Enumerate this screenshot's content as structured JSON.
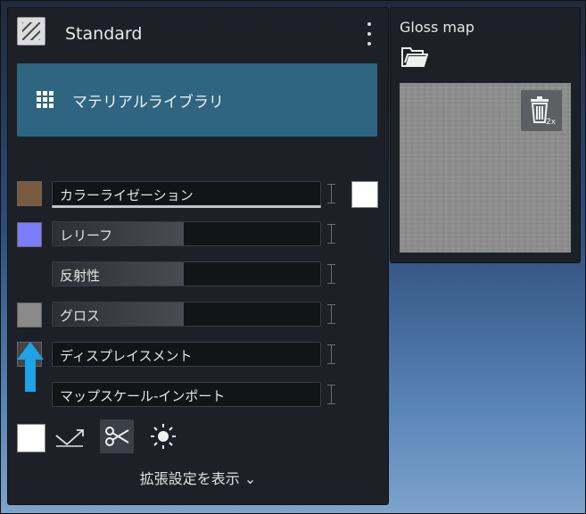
{
  "material": {
    "title": "Standard"
  },
  "library_button": {
    "label": "マテリアルライブラリ"
  },
  "layers": [
    {
      "label": "カラーライゼーション",
      "swatch_color": "#7a5a3c",
      "fill_percent": 0
    },
    {
      "label": "レリーフ",
      "swatch_color": "#7c7cff",
      "fill_percent": 49
    },
    {
      "label": "反射性",
      "swatch_color": "",
      "fill_percent": 49
    },
    {
      "label": "グロス",
      "swatch_color": "#8a8a8a",
      "fill_percent": 49
    },
    {
      "label": "ディスプレイスメント",
      "swatch_color": "#444444",
      "fill_percent": 0
    },
    {
      "label": "マップスケール-インポート",
      "swatch_color": "",
      "fill_percent": 0
    }
  ],
  "advanced": {
    "label": "拡張設定を表示 ⌄"
  },
  "gloss_panel": {
    "title": "Gloss map",
    "trash_badge": "2x"
  },
  "colors": {
    "accent": "#2f6580",
    "arrow": "#1fa2e6"
  }
}
